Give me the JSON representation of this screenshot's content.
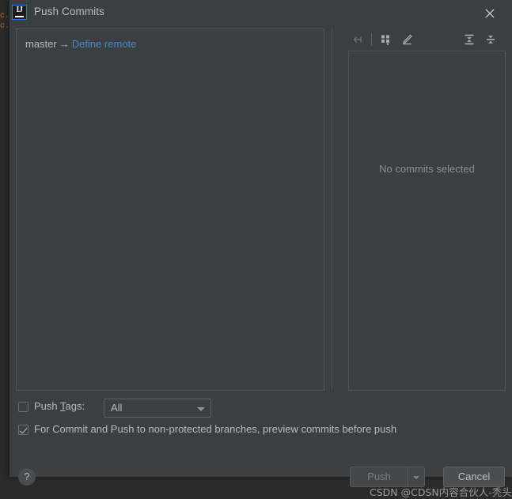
{
  "backdrop": {
    "code_ghost": "c.\nc."
  },
  "titlebar": {
    "app_icon_letters": "IJ",
    "title": "Push Commits",
    "close_icon": "close-icon"
  },
  "commit_list": {
    "branch": "master",
    "arrow": "→",
    "remote_link": "Define remote"
  },
  "detail_toolbar": {
    "buttons": [
      {
        "name": "collapse-to-left-icon",
        "label": ""
      },
      {
        "name": "show-diff-preview-icon",
        "label": ""
      },
      {
        "name": "edit-commit-message-icon",
        "label": ""
      },
      {
        "name": "expand-all-icon",
        "label": ""
      },
      {
        "name": "collapse-all-icon",
        "label": ""
      }
    ]
  },
  "detail_panel": {
    "empty_text": "No commits selected"
  },
  "options": {
    "push_tags_label_pre": "Push ",
    "push_tags_label_mnemonic": "T",
    "push_tags_label_post": "ags:",
    "push_tags_checked": false,
    "push_tags_value": "All",
    "push_tags_options": [
      "All"
    ],
    "preview_label": "For Commit and Push to non-protected branches, preview commits before push",
    "preview_checked": true
  },
  "footer": {
    "help_label": "?",
    "push_label": "Push",
    "push_enabled": false,
    "cancel_label": "Cancel"
  },
  "watermark": {
    "text": "CSDN @CDSN内容合伙人-秃头"
  },
  "colors": {
    "dialog_bg": "#3c3f41",
    "panel_border": "#515456",
    "text": "#bbbbbb",
    "muted_text": "#8b8f91",
    "link": "#4a88c7",
    "accent_blue": "#2d7cd6",
    "disabled_text": "#7a7d7f",
    "backdrop": "#2b2b2b"
  }
}
